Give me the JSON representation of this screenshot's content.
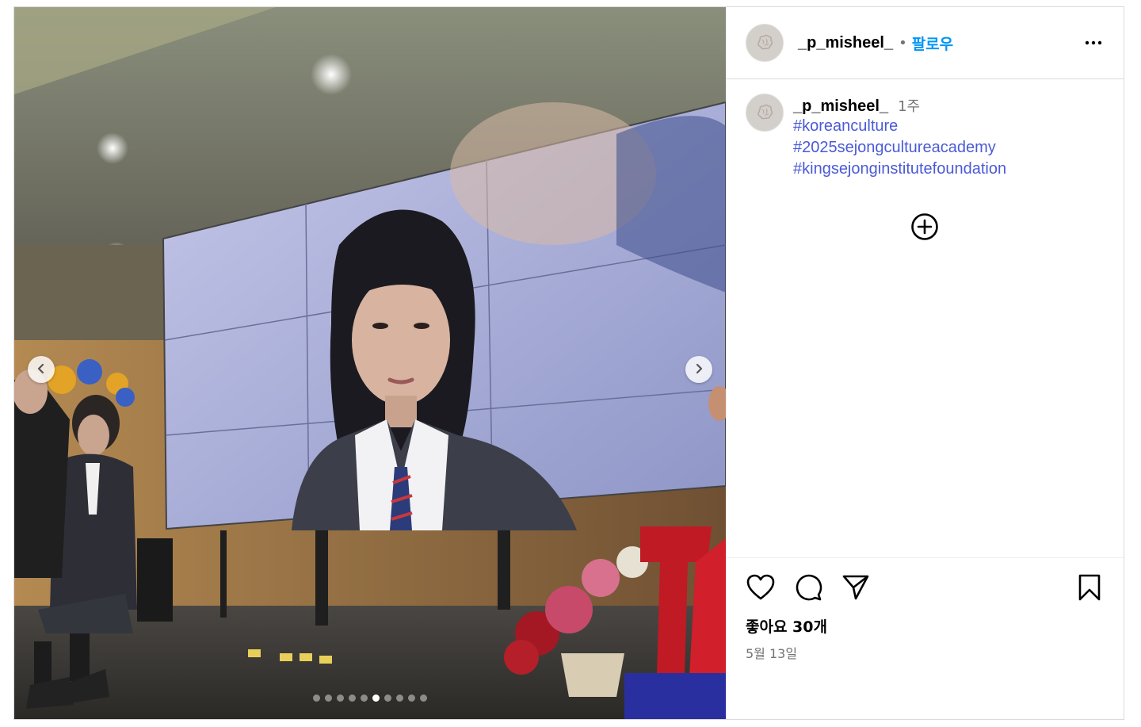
{
  "post": {
    "username": "_p_misheel_",
    "separator": "•",
    "follow_label": "팔로우",
    "more_icon": "more-options-icon"
  },
  "media": {
    "carousel_count": 10,
    "active_index": 5,
    "prev_icon": "chevron-left-icon",
    "next_icon": "chevron-right-icon"
  },
  "caption": {
    "username": "_p_misheel_",
    "time": "1주",
    "hashtags": [
      "#koreanculture",
      "#2025sejongcultureacademy",
      "#kingsejonginstitutefoundation"
    ]
  },
  "actions": {
    "like_icon": "heart-icon",
    "comment_icon": "comment-icon",
    "share_icon": "share-icon",
    "save_icon": "bookmark-icon",
    "add_comment_icon": "plus-circle-icon",
    "likes_text": "좋아요 30개",
    "date": "5월 13일"
  },
  "colors": {
    "link": "#4a5ad6",
    "follow": "#0095f6",
    "muted": "#737373",
    "border": "#dbdbdb"
  }
}
